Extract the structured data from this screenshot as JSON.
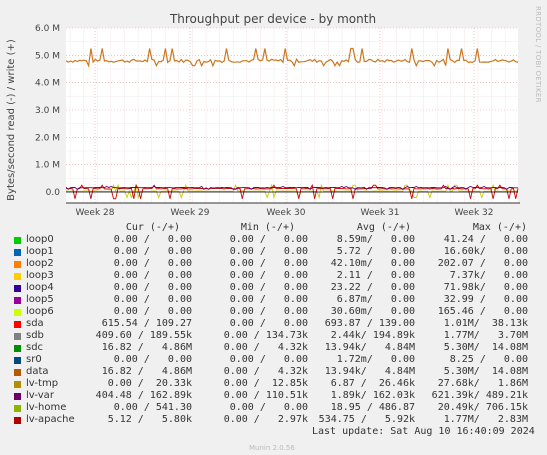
{
  "chart_data": {
    "type": "line",
    "title": "Throughput per device - by month",
    "ylabel": "Bytes/second read (-) / write (+)",
    "ylim": [
      -0.4,
      6.0
    ],
    "y_ticks": [
      "6.0 M",
      "5.0 M",
      "4.0 M",
      "3.0 M",
      "2.0 M",
      "1.0 M",
      "0.0"
    ],
    "y_tick_values": [
      6.0,
      5.0,
      4.0,
      3.0,
      2.0,
      1.0,
      0.0
    ],
    "x_ticks": [
      "Week 28",
      "Week 29",
      "Week 30",
      "Week 31",
      "Week 32"
    ],
    "grid": true,
    "series": [
      {
        "name": "data",
        "color": "#cc7722",
        "baseline": 4.8,
        "spike": 5.25,
        "dip": 4.62
      },
      {
        "name": "lv-tmp",
        "color": "#cccc00",
        "baseline": 0.03,
        "spike": 0.25,
        "dip": -0.2
      },
      {
        "name": "sdb",
        "color": "#cc0000",
        "baseline": 0.12,
        "spike": 0.25,
        "dip": -0.25
      },
      {
        "name": "lv-var",
        "color": "#550077",
        "baseline": 0.16,
        "spike": 0.2,
        "dip": 0.1
      }
    ]
  },
  "side_text": "RRDTOOL / TOBI OETIKER",
  "legend": {
    "headers": {
      "cur": "Cur (-/+)",
      "min": "Min (-/+)",
      "avg": "Avg (-/+)",
      "max": "Max (-/+)"
    },
    "rows": [
      {
        "name": "loop0",
        "color": "#00cc00",
        "cur": "0.00 /   0.00",
        "min": "0.00 /   0.00",
        "avg": "8.59m/   0.00",
        "max": "41.24 /   0.00"
      },
      {
        "name": "loop1",
        "color": "#0066b3",
        "cur": "0.00 /   0.00",
        "min": "0.00 /   0.00",
        "avg": "5.72 /   0.00",
        "max": "16.60k/   0.00"
      },
      {
        "name": "loop2",
        "color": "#ff8000",
        "cur": "0.00 /   0.00",
        "min": "0.00 /   0.00",
        "avg": "42.10m/   0.00",
        "max": "202.07 /   0.00"
      },
      {
        "name": "loop3",
        "color": "#ffcc00",
        "cur": "0.00 /   0.00",
        "min": "0.00 /   0.00",
        "avg": "2.11 /   0.00",
        "max": "7.37k/   0.00"
      },
      {
        "name": "loop4",
        "color": "#330099",
        "cur": "0.00 /   0.00",
        "min": "0.00 /   0.00",
        "avg": "23.22 /   0.00",
        "max": "71.98k/   0.00"
      },
      {
        "name": "loop5",
        "color": "#990099",
        "cur": "0.00 /   0.00",
        "min": "0.00 /   0.00",
        "avg": "6.87m/   0.00",
        "max": "32.99 /   0.00"
      },
      {
        "name": "loop6",
        "color": "#ccff00",
        "cur": "0.00 /   0.00",
        "min": "0.00 /   0.00",
        "avg": "30.60m/   0.00",
        "max": "165.46 /   0.00"
      },
      {
        "name": "sda",
        "color": "#ff0000",
        "cur": "615.54 / 109.27",
        "min": "0.00 /   0.00",
        "avg": "693.87 / 139.00",
        "max": "1.01M/  38.13k"
      },
      {
        "name": "sdb",
        "color": "#808080",
        "cur": "409.60 / 189.55k",
        "min": "0.00 / 134.73k",
        "avg": "2.44k/ 194.89k",
        "max": "1.77M/   3.70M"
      },
      {
        "name": "sdc",
        "color": "#008f00",
        "cur": "16.82 /   4.86M",
        "min": "0.00 /   4.32k",
        "avg": "13.94k/   4.84M",
        "max": "5.30M/  14.08M"
      },
      {
        "name": "sr0",
        "color": "#00487d",
        "cur": "0.00 /   0.00",
        "min": "0.00 /   0.00",
        "avg": "1.72m/   0.00",
        "max": "8.25 /   0.00"
      },
      {
        "name": "data",
        "color": "#b35a00",
        "cur": "16.82 /   4.86M",
        "min": "0.00 /   4.32k",
        "avg": "13.94k/   4.84M",
        "max": "5.30M/  14.08M"
      },
      {
        "name": "lv-tmp",
        "color": "#b38f00",
        "cur": "0.00 /  20.33k",
        "min": "0.00 /  12.85k",
        "avg": "6.87 /  26.46k",
        "max": "27.68k/   1.86M"
      },
      {
        "name": "lv-var",
        "color": "#6b006b",
        "cur": "404.48 / 162.89k",
        "min": "0.00 / 110.51k",
        "avg": "1.89k/ 162.03k",
        "max": "621.39k/ 489.21k"
      },
      {
        "name": "lv-home",
        "color": "#8fb300",
        "cur": "0.00 / 541.30",
        "min": "0.00 /   0.00",
        "avg": "18.95 / 486.87",
        "max": "20.49k/ 706.15k"
      },
      {
        "name": "lv-apache",
        "color": "#b30000",
        "cur": "5.12 /   5.80k",
        "min": "0.00 /   2.97k",
        "avg": "534.75 /   5.92k",
        "max": "1.77M/   2.83M"
      }
    ]
  },
  "last_update": "Last update: Sat Aug 10 16:40:09 2024",
  "footer": "Munin 2.0.56"
}
